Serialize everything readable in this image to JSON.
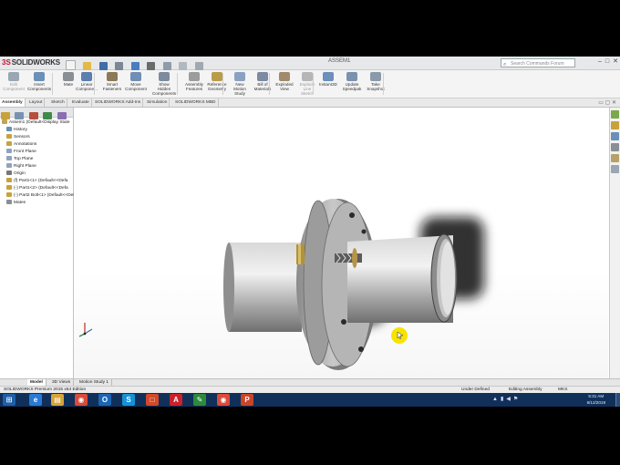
{
  "app": {
    "brand_prefix": "3S",
    "brand_name": "SOLIDWORKS",
    "document_title": "ASSEM1",
    "search_placeholder": "Search Commands Forum",
    "window_controls": [
      "–",
      "□",
      "✕"
    ]
  },
  "ribbon": {
    "buttons": [
      {
        "label": "Edit\nComponent",
        "icon": "edit-component-icon",
        "color": "#9aa6b2",
        "enabled": false
      },
      {
        "label": "Insert\nComponents",
        "icon": "insert-components-icon",
        "color": "#6a8fb8",
        "enabled": true
      },
      {
        "label": "Mate",
        "icon": "mate-icon",
        "color": "#8a8f96",
        "enabled": true
      },
      {
        "label": "Linear\nCompone...",
        "icon": "linear-pattern-icon",
        "color": "#5b7fae",
        "enabled": true
      },
      {
        "label": "Smart\nFasteners",
        "icon": "smart-fasteners-icon",
        "color": "#8b7a55",
        "enabled": true
      },
      {
        "label": "Move\nComponent",
        "icon": "move-component-icon",
        "color": "#6f8fb4",
        "enabled": true
      },
      {
        "label": "Show\nHidden\nComponents",
        "icon": "show-hidden-icon",
        "color": "#7c8c9e",
        "enabled": true
      },
      {
        "label": "Assembly\nFeatures",
        "icon": "assembly-features-icon",
        "color": "#9c9c9c",
        "enabled": true
      },
      {
        "label": "Reference\nGeometry",
        "icon": "reference-geometry-icon",
        "color": "#b99b4a",
        "enabled": true
      },
      {
        "label": "New\nMotion\nStudy",
        "icon": "motion-study-icon",
        "color": "#8aa2c2",
        "enabled": true
      },
      {
        "label": "Bill of\nMaterials",
        "icon": "bill-of-materials-icon",
        "color": "#7c8aa2",
        "enabled": true
      },
      {
        "label": "Exploded\nView",
        "icon": "exploded-view-icon",
        "color": "#a28a6c",
        "enabled": true
      },
      {
        "label": "Explode\nLine\nSketch",
        "icon": "explode-line-icon",
        "color": "#b6b6b6",
        "enabled": false
      },
      {
        "label": "Instant3D",
        "icon": "instant3d-icon",
        "color": "#6c8fbc",
        "enabled": true
      },
      {
        "label": "Update\nSpeedpak",
        "icon": "speedpak-icon",
        "color": "#7a92b0",
        "enabled": true
      },
      {
        "label": "Take\nSnapshot",
        "icon": "snapshot-icon",
        "color": "#8a9aac",
        "enabled": true
      }
    ]
  },
  "command_tabs": [
    "Assembly",
    "Layout",
    "Sketch",
    "Evaluate",
    "SOLIDWORKS Add-Ins",
    "Simulation",
    "SOLIDWORKS MBD"
  ],
  "active_command_tab": "Assembly",
  "feature_tree": [
    {
      "label": "Assem1  (Default<Display State",
      "icon": "assembly-icon",
      "color": "#c2a45a",
      "indent": 0
    },
    {
      "label": "History",
      "icon": "history-icon",
      "color": "#6a8fb8",
      "indent": 1
    },
    {
      "label": "Sensors",
      "icon": "sensors-icon",
      "color": "#c9a23e",
      "indent": 1
    },
    {
      "label": "Annotations",
      "icon": "annotations-icon",
      "color": "#c9a23e",
      "indent": 1
    },
    {
      "label": "Front Plane",
      "icon": "plane-icon",
      "color": "#8fa3bd",
      "indent": 1
    },
    {
      "label": "Top Plane",
      "icon": "plane-icon",
      "color": "#8fa3bd",
      "indent": 1
    },
    {
      "label": "Right Plane",
      "icon": "plane-icon",
      "color": "#8fa3bd",
      "indent": 1
    },
    {
      "label": "Origin",
      "icon": "origin-icon",
      "color": "#777777",
      "indent": 1
    },
    {
      "label": "(f) Part1<1> (Default<<Defa",
      "icon": "part-icon",
      "color": "#c8a13a",
      "indent": 1
    },
    {
      "label": "(-) Part1<2> (Default<<Defa",
      "icon": "part-icon",
      "color": "#c8a13a",
      "indent": 1
    },
    {
      "label": "(-) Part2 Bolt<1> (Default<<Def",
      "icon": "part-icon",
      "color": "#c8a13a",
      "indent": 1
    },
    {
      "label": "Mates",
      "icon": "mates-icon",
      "color": "#8a8f96",
      "indent": 1
    }
  ],
  "model_tabs": [
    "Model",
    "3D Views",
    "Motion Study 1"
  ],
  "active_model_tab": "Model",
  "status_bar": {
    "edition": "SOLIDWORKS Premium 2015 x64 Edition",
    "status": "Under Defined",
    "mode": "Editing Assembly",
    "units": "MKS"
  },
  "taskbar": {
    "apps": [
      {
        "name": "start-button",
        "glyph": "⊞",
        "color": "#1e5fa8"
      },
      {
        "name": "ie-icon",
        "glyph": "e",
        "color": "#2a7ad5"
      },
      {
        "name": "explorer-icon",
        "glyph": "▤",
        "color": "#d6a53a"
      },
      {
        "name": "chrome-icon",
        "glyph": "◉",
        "color": "#d94b3a"
      },
      {
        "name": "outlook-icon",
        "glyph": "O",
        "color": "#1b65b5"
      },
      {
        "name": "skype-icon",
        "glyph": "S",
        "color": "#1592d6"
      },
      {
        "name": "office-icon",
        "glyph": "□",
        "color": "#d24a2a"
      },
      {
        "name": "acrobat-icon",
        "glyph": "A",
        "color": "#c9222a"
      },
      {
        "name": "paint-icon",
        "glyph": "✎",
        "color": "#2c8a3c"
      },
      {
        "name": "chrome2-icon",
        "glyph": "◉",
        "color": "#d94b3a"
      },
      {
        "name": "powerpoint-icon",
        "glyph": "P",
        "color": "#c9452a"
      }
    ],
    "time": "5:31 AM",
    "date": "6/12/2019"
  }
}
